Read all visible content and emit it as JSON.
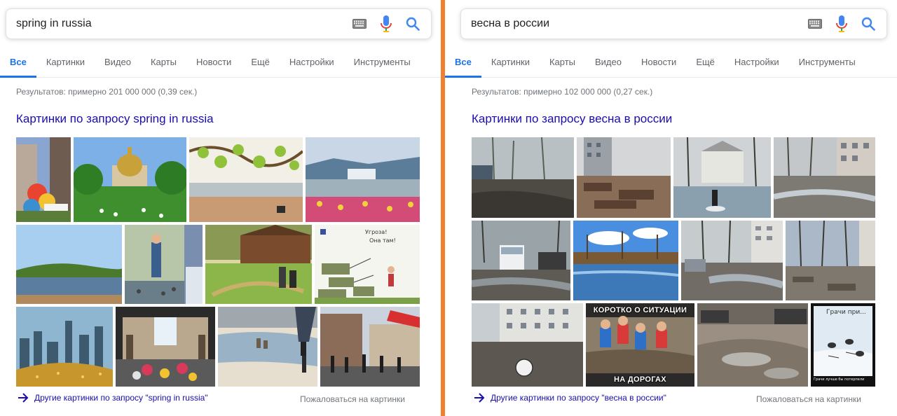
{
  "colors": {
    "divider": "#f07f2e",
    "accent": "#1a73e8",
    "link": "#1a0dab",
    "mic_blue": "#4285f4",
    "mic_red": "#ea4335"
  },
  "icons": {
    "keyboard": "keyboard-icon",
    "mic": "microphone-icon",
    "search": "search-icon",
    "more": "arrow-right-icon"
  },
  "left": {
    "search": {
      "value": "spring in russia"
    },
    "tabs": [
      "Все",
      "Картинки",
      "Видео",
      "Карты",
      "Новости",
      "Ещё",
      "Настройки",
      "Инструменты"
    ],
    "active_tab": "Все",
    "stats": "Результатов: примерно 201 000 000 (0,39 сек.)",
    "images_heading": "Картинки по запросу spring in russia",
    "comic_text": [
      "Угроза!",
      "Она там!"
    ],
    "more_link": "Другие картинки по запросу \"spring in russia\"",
    "report_link": "Пожаловаться на картинки"
  },
  "right": {
    "search": {
      "value": "весна в россии"
    },
    "tabs": [
      "Все",
      "Картинки",
      "Карты",
      "Видео",
      "Новости",
      "Ещё",
      "Настройки",
      "Инструменты"
    ],
    "active_tab": "Все",
    "stats": "Результатов: примерно 102 000 000 (0,27 сек.)",
    "images_heading": "Картинки по запросу весна в россии",
    "meme_top": "КОРОТКО О СИТУАЦИИ",
    "meme_bottom": "НА ДОРОГАХ",
    "comic_title": "Грачи при...",
    "comic_caption": "Грачи лучше бы потерпели",
    "more_link": "Другие картинки по запросу \"весна в россии\"",
    "report_link": "Пожаловаться на картинки"
  }
}
